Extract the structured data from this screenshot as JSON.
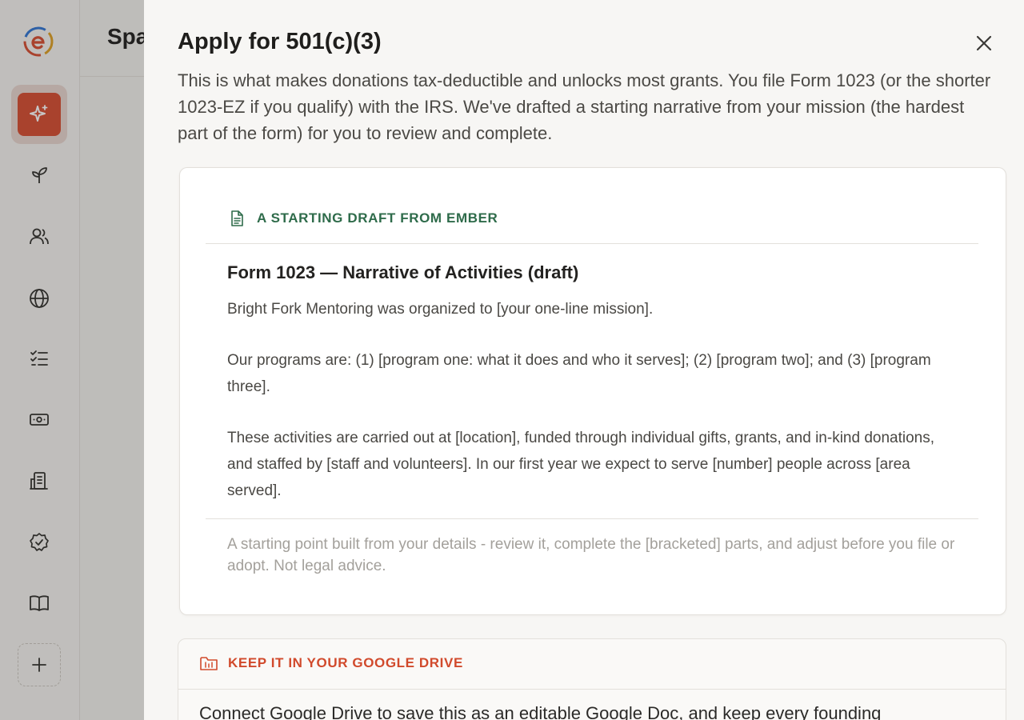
{
  "background": {
    "page_title": "Spa"
  },
  "sheet": {
    "title": "Apply for 501(c)(3)",
    "description": "This is what makes donations tax-deductible and unlocks most grants. You file Form 1023 (or the shorter 1023-EZ if you qualify) with the IRS. We've drafted a starting narrative from your mission (the hardest part of the form) for you to review and complete."
  },
  "draft_card": {
    "section_label": "A STARTING DRAFT FROM EMBER",
    "heading": "Form 1023 — Narrative of Activities (draft)",
    "paragraphs": [
      "Bright Fork Mentoring was organized to [your one-line mission].",
      "Our programs are: (1) [program one: what it does and who it serves]; (2) [program two]; and (3) [program three].",
      "These activities are carried out at [location], funded through individual gifts, grants, and in-kind donations, and staffed by [staff and volunteers]. In our first year we expect to serve [number] people across [area served]."
    ],
    "note": "A starting point built from your details - review it, complete the [bracketed] parts, and adjust before you file or adopt. Not legal advice."
  },
  "drive_card": {
    "section_label": "KEEP IT IN YOUR GOOGLE DRIVE",
    "text": "Connect Google Drive to save this as an editable Google Doc, and keep every founding"
  },
  "icons": {
    "rail": [
      "ember-logo-icon",
      "sparkle-icon",
      "sprout-icon",
      "users-icon",
      "globe-icon",
      "checklist-icon",
      "cash-icon",
      "building-icon",
      "badge-check-icon",
      "book-open-icon",
      "plus-icon"
    ],
    "draft": "document-icon",
    "drive": "folder-drive-icon",
    "close": "close-icon"
  },
  "colors": {
    "accent": "#d9553a",
    "green_label": "#2e6b4a",
    "orange_label": "#d14a2c"
  }
}
